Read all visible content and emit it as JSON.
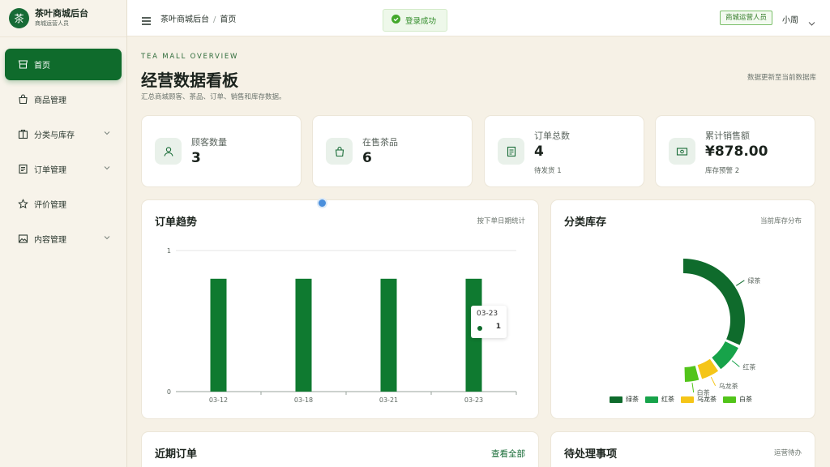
{
  "brand": {
    "logo_char": "茶",
    "title": "茶叶商城后台",
    "subtitle": "商城运营人员"
  },
  "sidebar": {
    "items": [
      {
        "label": "首页",
        "icon": "store-icon",
        "active": true
      },
      {
        "label": "商品管理",
        "icon": "bag-icon"
      },
      {
        "label": "分类与库存",
        "icon": "box-icon",
        "expandable": true
      },
      {
        "label": "订单管理",
        "icon": "receipt-icon",
        "expandable": true
      },
      {
        "label": "评价管理",
        "icon": "star-icon"
      },
      {
        "label": "内容管理",
        "icon": "image-icon",
        "expandable": true
      }
    ]
  },
  "header": {
    "breadcrumb": [
      "茶叶商城后台",
      "首页"
    ],
    "toast": "登录成功",
    "role_tag": "商城运营人员",
    "user": "小周"
  },
  "page": {
    "eyebrow": "TEA MALL OVERVIEW",
    "title": "经营数据看板",
    "description": "汇总商城顾客、茶品、订单、销售和库存数据。",
    "update_note": "数据更新至当前数据库"
  },
  "stats": [
    {
      "label": "顾客数量",
      "value": "3",
      "sub": "",
      "icon": "user-icon"
    },
    {
      "label": "在售茶品",
      "value": "6",
      "sub": "",
      "icon": "bag-icon"
    },
    {
      "label": "订单总数",
      "value": "4",
      "sub": "待发货 1",
      "icon": "receipt-icon"
    },
    {
      "label": "累计销售额",
      "value": "¥878.00",
      "sub": "库存预警 2",
      "icon": "money-icon"
    }
  ],
  "trend_card": {
    "title": "订单趋势",
    "note": "按下单日期统计",
    "tooltip_date": "03-23",
    "tooltip_value": "1"
  },
  "category_card": {
    "title": "分类库存",
    "note": "当前库存分布"
  },
  "recent_orders": {
    "title": "近期订单",
    "link": "查看全部"
  },
  "todo": {
    "title": "待处理事项",
    "note": "运营待办"
  },
  "colors": {
    "primary": "#0f6b2c",
    "green2": "#17a34a",
    "yellow": "#f5c518",
    "lime": "#52c41a"
  },
  "chart_data": [
    {
      "type": "bar",
      "categories": [
        "03-12",
        "03-18",
        "03-21",
        "03-23"
      ],
      "values": [
        0.8,
        0.8,
        0.8,
        0.8
      ],
      "yticks": [
        "0",
        "1"
      ],
      "ylim": [
        0,
        1
      ],
      "title": "订单趋势"
    },
    {
      "type": "pie",
      "style": "half-donut",
      "categories": [
        "绿茶",
        "红茶",
        "乌龙茶",
        "白茶"
      ],
      "values": [
        64,
        16,
        11,
        9
      ],
      "colors": [
        "#0f6b2c",
        "#17a34a",
        "#f5c518",
        "#52c41a"
      ],
      "title": "分类库存"
    }
  ]
}
